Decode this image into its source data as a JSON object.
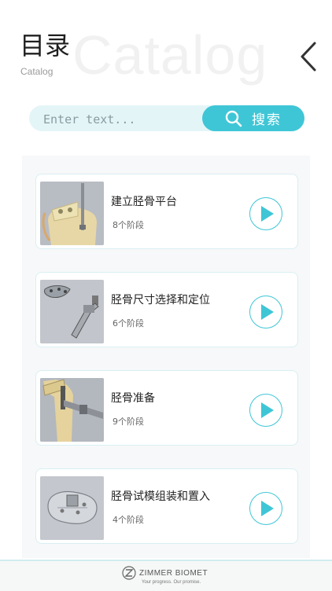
{
  "header": {
    "title": "目录",
    "subtitle": "Catalog",
    "watermark": "Catalog"
  },
  "search": {
    "placeholder": "Enter text...",
    "button_label": "搜索"
  },
  "items": [
    {
      "title": "建立胫骨平台",
      "stages": "8个阶段"
    },
    {
      "title": "胫骨尺寸选择和定位",
      "stages": "6个阶段"
    },
    {
      "title": "胫骨准备",
      "stages": "9个阶段"
    },
    {
      "title": "胫骨试模组装和置入",
      "stages": "4个阶段"
    }
  ],
  "footer": {
    "brand": "ZIMMER BIOMET",
    "tagline": "Your progress. Our promise."
  },
  "colors": {
    "accent": "#3fc6d6",
    "search_bg": "#e4f5f8"
  }
}
